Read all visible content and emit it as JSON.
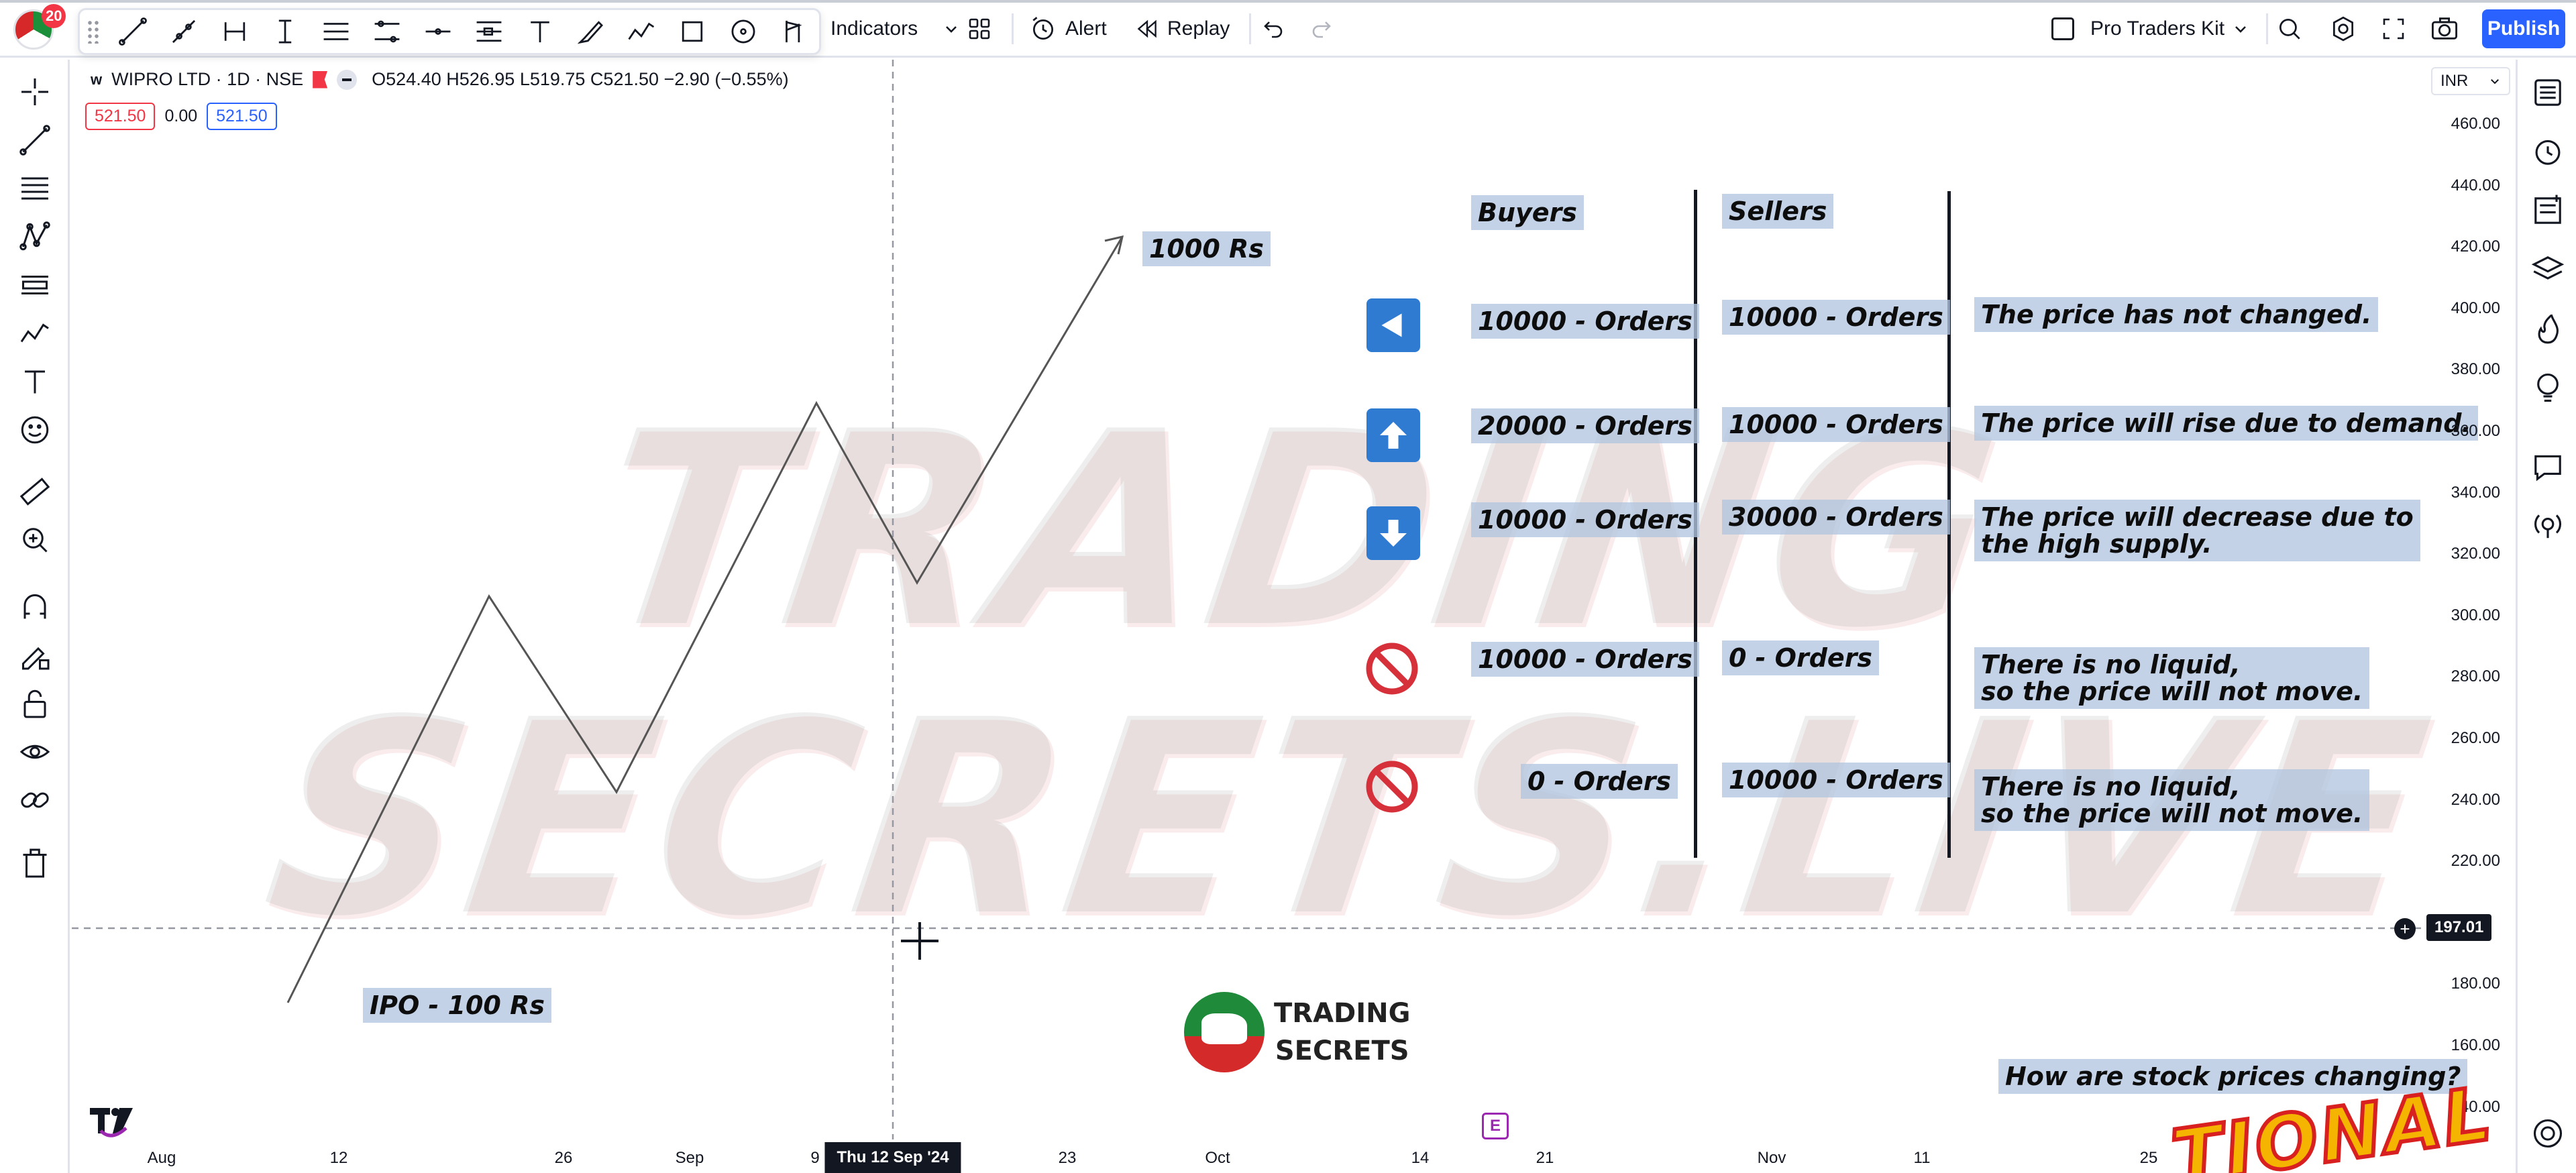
{
  "app": {
    "notification_count": "20",
    "indicators_label": "Indicators",
    "alert_label": "Alert",
    "replay_label": "Replay",
    "kit_label": "Pro Traders Kit",
    "publish_label": "Publish"
  },
  "legend": {
    "symbol": "WIPRO LTD · 1D · NSE",
    "ohlc": "O524.40 H526.95 L519.75 C521.50 −2.90 (−0.55%)",
    "sell_price": "521.50",
    "spread": "0.00",
    "buy_price": "521.50"
  },
  "price_scale": {
    "currency": "INR",
    "ticks": [
      "460.00",
      "440.00",
      "420.00",
      "400.00",
      "380.00",
      "360.00",
      "340.00",
      "320.00",
      "300.00",
      "280.00",
      "260.00",
      "240.00",
      "220.00",
      "180.00",
      "160.00",
      "140.00"
    ],
    "crosshair_price": "197.01"
  },
  "time_axis": {
    "labels": [
      "Aug",
      "12",
      "26",
      "Sep",
      "9",
      "23",
      "Oct",
      "14",
      "21",
      "Nov",
      "11",
      "25"
    ],
    "crosshair_date": "Thu 12 Sep '24"
  },
  "watermark": {
    "line1": "TRADING",
    "line2": "SECRETS.LIVE"
  },
  "annotations": {
    "target": "1000 Rs",
    "ipo": "IPO - 100 Rs",
    "buyers_header": "Buyers",
    "sellers_header": "Sellers",
    "question": "How are stock prices changing?",
    "rows": [
      {
        "icon": "left-arrow-icon",
        "buyers": "10000 - Orders",
        "sellers": "10000 - Orders",
        "result": "The price has not changed."
      },
      {
        "icon": "up-arrow-icon",
        "buyers": "20000 - Orders",
        "sellers": "10000 - Orders",
        "result": "The price will rise due to demand."
      },
      {
        "icon": "down-arrow-icon",
        "buyers": "10000 - Orders",
        "sellers": "30000 - Orders",
        "result": "The price will decrease due to\nthe high supply."
      },
      {
        "icon": "no-entry-icon",
        "buyers": "10000 - Orders",
        "sellers": "0 - Orders",
        "result": "There is no liquid,\nso the price will not move."
      },
      {
        "icon": "no-entry-icon",
        "buyers": "0 - Orders",
        "sellers": "10000 - Orders",
        "result": "There is no liquid,\nso the price will not move."
      }
    ]
  },
  "brand": {
    "line1": "TRADING",
    "line2": "SECRETS"
  },
  "earnings_badge": "E",
  "colors": {
    "accent": "#2962ff",
    "label_bg": "#b2c5df",
    "icon_blue": "#2e7bd1",
    "no_entry_red": "#d6303a"
  }
}
